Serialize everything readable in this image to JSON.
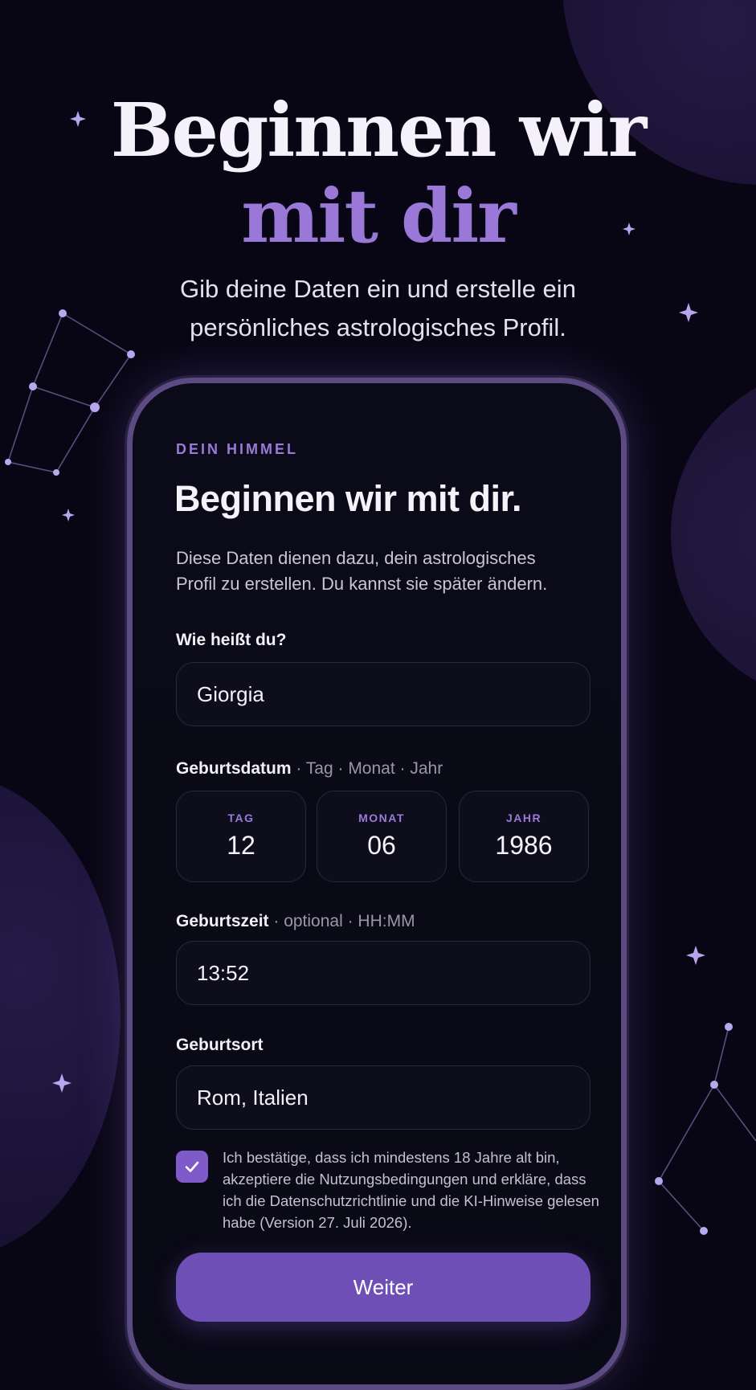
{
  "hero": {
    "title_line1": "Beginnen wir",
    "title_line2": "mit dir",
    "subtitle_line1": "Gib deine Daten ein und erstelle ein",
    "subtitle_line2": "persönliches astrologisches Profil."
  },
  "form": {
    "eyebrow": "DEIN HIMMEL",
    "title": "Beginnen wir mit dir.",
    "description_line1": "Diese Daten dienen dazu, dein astrologisches",
    "description_line2": "Profil zu erstellen. Du kannst sie später ändern.",
    "name": {
      "label": "Wie heißt du?",
      "value": "Giorgia"
    },
    "birthdate": {
      "label": "Geburtsdatum",
      "hint": " · Tag · Monat · Jahr",
      "day": {
        "label": "TAG",
        "value": "12"
      },
      "month": {
        "label": "MONAT",
        "value": "06"
      },
      "year": {
        "label": "JAHR",
        "value": "1986"
      }
    },
    "birthtime": {
      "label": "Geburtszeit",
      "hint": " · optional · HH:MM",
      "value": "13:52"
    },
    "birthplace": {
      "label": "Geburtsort",
      "value": "Rom, Italien"
    },
    "consent": {
      "checked": true,
      "text": "Ich bestätige, dass ich mindestens 18 Jahre alt bin, akzeptiere die Nutzungsbedingungen und erkläre, dass ich die Datenschutzrichtlinie und die KI-Hinweise gelesen habe (Version 27. Juli 2026)."
    },
    "submit_label": "Weiter"
  },
  "colors": {
    "background": "#080614",
    "accent": "#9a78d8",
    "button": "#6e4fb6"
  },
  "icons": [
    "sparkle-icon",
    "constellation-icon",
    "checkmark-icon"
  ]
}
